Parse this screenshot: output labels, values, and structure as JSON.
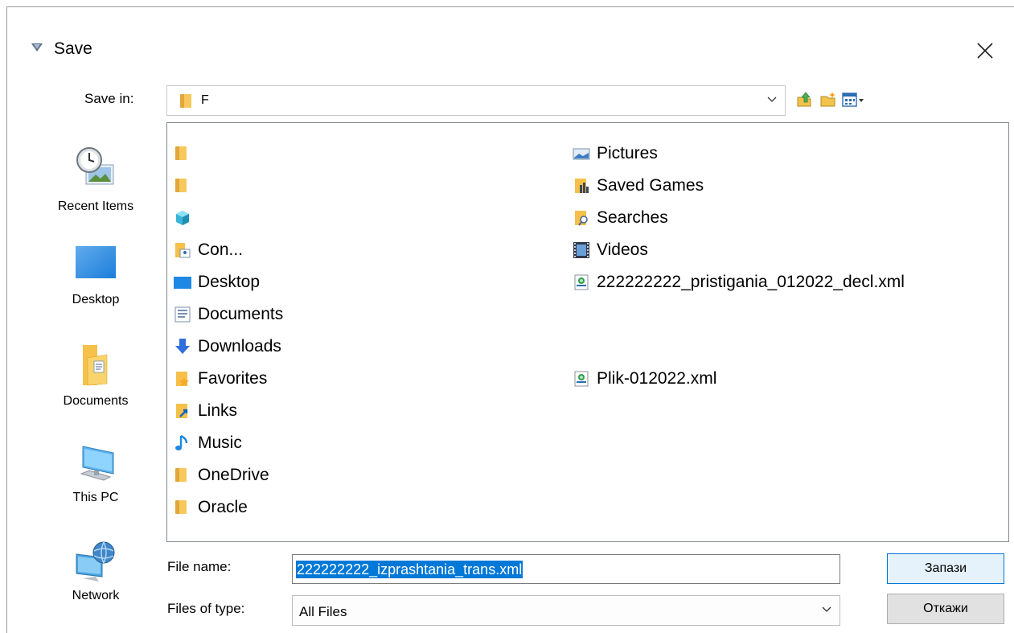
{
  "dialog": {
    "title": "Save",
    "save_in_label": "Save in:",
    "save_in_value": "F"
  },
  "sidebar": {
    "items": [
      {
        "label": "Recent Items",
        "icon": "recent-items-icon"
      },
      {
        "label": "Desktop",
        "icon": "desktop-icon"
      },
      {
        "label": "Documents",
        "icon": "documents-icon"
      },
      {
        "label": "This PC",
        "icon": "this-pc-icon"
      },
      {
        "label": "Network",
        "icon": "network-icon"
      }
    ]
  },
  "files": {
    "column1": [
      {
        "name": "",
        "icon": "folder-icon"
      },
      {
        "name": "",
        "icon": "folder-icon"
      },
      {
        "name": "",
        "icon": "3d-objects-icon"
      },
      {
        "name": "Con...",
        "icon": "contacts-icon"
      },
      {
        "name": "Desktop",
        "icon": "desktop-icon"
      },
      {
        "name": "Documents",
        "icon": "documents-icon"
      },
      {
        "name": "Downloads",
        "icon": "downloads-icon"
      },
      {
        "name": "Favorites",
        "icon": "favorites-icon"
      },
      {
        "name": "Links",
        "icon": "links-icon"
      },
      {
        "name": "Music",
        "icon": "music-icon"
      },
      {
        "name": "OneDrive",
        "icon": "folder-icon"
      },
      {
        "name": "Oracle",
        "icon": "folder-icon"
      }
    ],
    "column2": [
      {
        "name": "Pictures",
        "icon": "pictures-icon"
      },
      {
        "name": "Saved Games",
        "icon": "saved-games-icon"
      },
      {
        "name": "Searches",
        "icon": "searches-icon"
      },
      {
        "name": "Videos",
        "icon": "videos-icon"
      },
      {
        "name": "222222222_pristigania_012022_decl.xml",
        "icon": "xml-file-icon"
      },
      {
        "name": "Plik-012022.xml",
        "icon": "xml-file-icon"
      }
    ]
  },
  "form": {
    "file_name_label": "File name:",
    "file_name_value": "222222222_izprashtania_trans.xml",
    "file_type_label": "Files of type:",
    "file_type_value": "All Files"
  },
  "buttons": {
    "save": "Запази",
    "cancel": "Откажи"
  }
}
